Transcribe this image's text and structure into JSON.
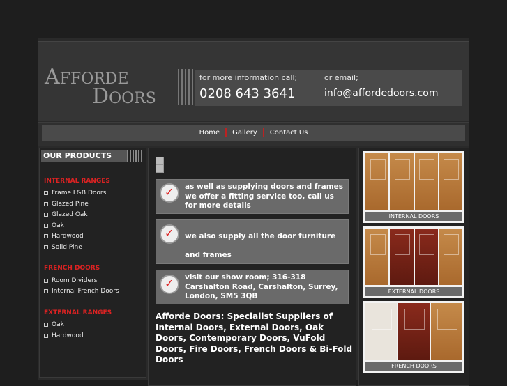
{
  "logo": {
    "line1_big": "A",
    "line1_small": "FFORDE",
    "line2_big": "D",
    "line2_small": "OORS"
  },
  "contact": {
    "phone_label": "for more information call;",
    "phone": "0208 643 3641",
    "email_label": "or email;",
    "email": "info@affordedoors.com"
  },
  "nav": {
    "items": [
      "Home",
      "Gallery",
      "Contact Us"
    ]
  },
  "sidebar": {
    "title": "OUR PRODUCTS",
    "groups": [
      {
        "heading": "INTERNAL RANGES",
        "links": [
          "Frame L&B Doors",
          "Glazed Pine",
          "Glazed Oak",
          "Oak",
          "Hardwood",
          "Solid Pine"
        ]
      },
      {
        "heading": "FRENCH DOORS",
        "links": [
          "Room Dividers",
          "Internal French Doors"
        ]
      },
      {
        "heading": "EXTERNAL RANGES",
        "links": [
          "Oak",
          "Hardwood"
        ]
      }
    ]
  },
  "main": {
    "boxes": [
      {
        "text": "as well as supplying doors and frames we offer a fitting service too, call us for more details"
      },
      {
        "text": "we also supply all the door furniture and frames"
      },
      {
        "text": "visit our show room; 316-318 Carshalton Road, Carshalton, Surrey, London, SM5 3QB"
      }
    ],
    "heading": "Afforde Doors: Specialist Suppliers of Internal Doors, External Doors, Oak Doors, Contemporary Doors, VuFold Doors, Fire Doors, French Doors & Bi-Fold Doors"
  },
  "right": {
    "cards": [
      {
        "caption": "INTERNAL DOORS",
        "style": "wood"
      },
      {
        "caption": "EXTERNAL DOORS",
        "style": "wood"
      },
      {
        "caption": "FRENCH DOORS",
        "style": "mixed"
      }
    ]
  },
  "colors": {
    "accent": "#dd2222",
    "panel": "#6a6a6a",
    "background": "#1e1e1e"
  }
}
